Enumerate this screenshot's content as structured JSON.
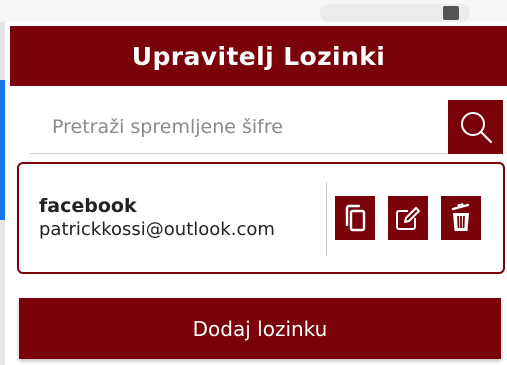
{
  "header": {
    "title": "Upravitelj Lozinki"
  },
  "search": {
    "placeholder": "Pretraži spremljene šifre",
    "value": "",
    "icon": "search-icon"
  },
  "entries": [
    {
      "site": "facebook",
      "username": "patrickkossi@outlook.com",
      "actions": {
        "copy_icon": "copy-icon",
        "edit_icon": "edit-icon",
        "delete_icon": "trash-icon"
      }
    }
  ],
  "footer": {
    "add_label": "Dodaj lozinku"
  },
  "colors": {
    "accent": "#790308",
    "background": "#ffffff",
    "text": "#222222"
  }
}
